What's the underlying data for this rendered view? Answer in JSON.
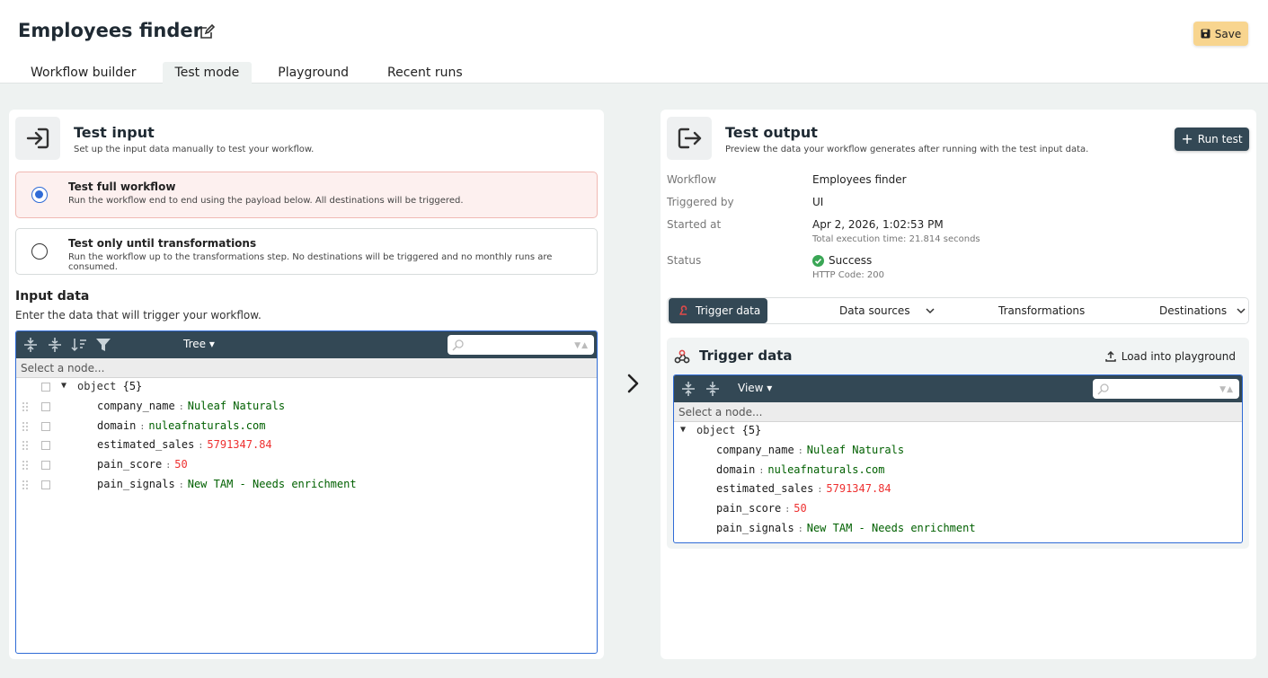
{
  "app": {
    "title": "Employees finder",
    "save_label": "Save"
  },
  "tabs": [
    {
      "label": "Workflow builder",
      "active": false
    },
    {
      "label": "Test mode",
      "active": true
    },
    {
      "label": "Playground",
      "active": false
    },
    {
      "label": "Recent runs",
      "active": false
    }
  ],
  "test_input": {
    "title": "Test input",
    "subtitle": "Set up the input data manually to test your workflow.",
    "options": [
      {
        "title": "Test full workflow",
        "desc": "Run the workflow end to end using the payload below. All destinations will be triggered.",
        "selected": true
      },
      {
        "title": "Test only until transformations",
        "desc": "Run the workflow up to the transformations step. No destinations will be triggered and no monthly runs are consumed.",
        "selected": false
      }
    ],
    "input_title": "Input data",
    "input_subtitle": "Enter the data that will trigger your workflow.",
    "editor": {
      "mode": "Tree",
      "node_placeholder": "Select a node...",
      "root_key": "object",
      "root_count": "{5}",
      "fields": [
        {
          "key": "company_name",
          "value": "Nuleaf Naturals",
          "type": "string"
        },
        {
          "key": "domain",
          "value": "nuleafnaturals.com",
          "type": "string"
        },
        {
          "key": "estimated_sales",
          "value": "5791347.84",
          "type": "number"
        },
        {
          "key": "pain_score",
          "value": "50",
          "type": "number"
        },
        {
          "key": "pain_signals",
          "value": "New TAM - Needs enrichment",
          "type": "string"
        }
      ]
    }
  },
  "test_output": {
    "title": "Test output",
    "subtitle": "Preview the data your workflow generates after running with the test input data.",
    "run_label": "Run test",
    "details": {
      "workflow_label": "Workflow",
      "workflow_value": "Employees finder",
      "triggered_label": "Triggered by",
      "triggered_value": "UI",
      "started_label": "Started at",
      "started_value": "Apr 2, 2026, 1:02:53 PM",
      "started_sub": "Total execution time: 21.814 seconds",
      "status_label": "Status",
      "status_value": "Success",
      "status_sub": "HTTP Code: 200"
    },
    "steps": [
      "Trigger data",
      "Data sources",
      "Transformations",
      "Destinations"
    ],
    "trigger_title": "Trigger data",
    "load_label": "Load into playground",
    "editor": {
      "mode": "View",
      "node_placeholder": "Select a node...",
      "root_key": "object",
      "root_count": "{5}"
    }
  },
  "colors": {
    "accent": "#334855",
    "save": "#f8d58f",
    "selected_bg": "#fdf0ef",
    "success": "#3aa655",
    "string": "#006000",
    "number": "#ee3030"
  }
}
